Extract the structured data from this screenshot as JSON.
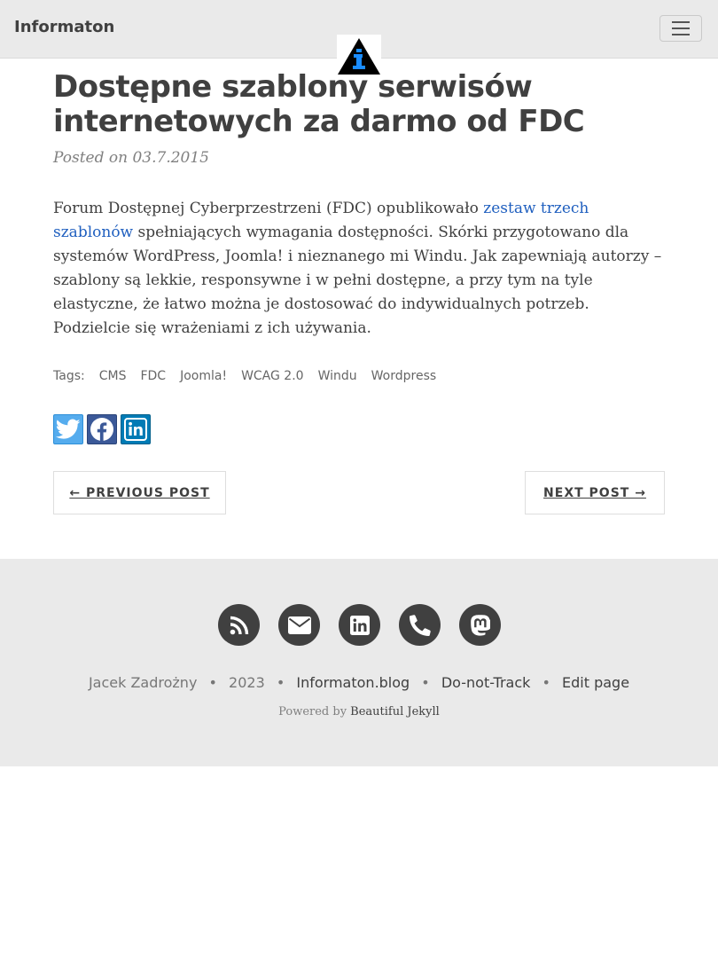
{
  "nav": {
    "brand": "Informaton",
    "toggle_icon": "hamburger-icon",
    "avatar_icon": "info-triangle-logo"
  },
  "post": {
    "title": "Dostępne szablony serwisów internetowych za darmo od FDC",
    "meta": "Posted on 03.7.2015",
    "body_before": "Forum Dostępnej Cyberprzestrzeni (FDC) opublikowało ",
    "body_link": "zestaw trzech szablonów",
    "body_after": " spełniających wymagania dostępności. Skórki przygotowano dla systemów WordPress, Joomla! i nieznanego mi Windu. Jak zapewniają autorzy – szablony są lekkie, responsywne i w pełni dostępne, a przy tym na tyle elastyczne, że łatwo można je dostosować do indywidualnych potrzeb. Podzielcie się wrażeniami z ich używania.",
    "tags_label": "Tags:",
    "tags": [
      "CMS",
      "FDC",
      "Joomla!",
      "WCAG 2.0",
      "Windu",
      "Wordpress"
    ]
  },
  "share": {
    "icons": [
      "twitter-icon",
      "facebook-icon",
      "linkedin-icon"
    ],
    "colors": {
      "twitter": "#55acee",
      "facebook": "#3b5998",
      "linkedin": "#007bb5"
    }
  },
  "pager": {
    "previous": "← PREVIOUS POST",
    "next": "NEXT POST →"
  },
  "footer": {
    "social_icons": [
      "rss-icon",
      "envelope-icon",
      "linkedin-icon",
      "phone-icon",
      "mastodon-icon"
    ],
    "author": "Jacek Zadrożny",
    "sep": "•",
    "year": "2023",
    "site": "Informaton.blog",
    "dnt": "Do-not-Track",
    "edit": "Edit page",
    "powered_prefix": "Powered by ",
    "powered_link": "Beautiful Jekyll"
  }
}
